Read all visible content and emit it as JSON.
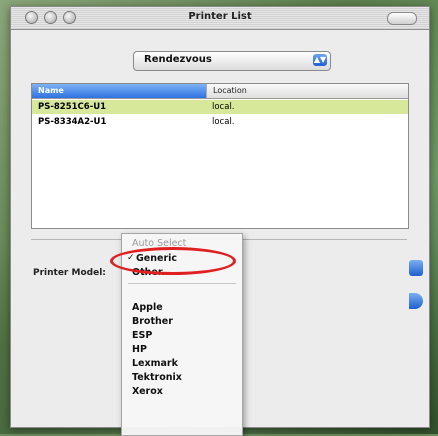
{
  "window": {
    "title": "Printer List"
  },
  "popup": {
    "label": "Rendezvous"
  },
  "list": {
    "headers": {
      "name": "Name",
      "location": "Location"
    },
    "rows": [
      {
        "name": "PS-8251C6-U1",
        "location": "local."
      },
      {
        "name": "PS-8334A2-U1",
        "location": "local."
      }
    ]
  },
  "printer_model": {
    "label": "Printer Model:"
  },
  "menu": {
    "items": [
      {
        "label": "Auto Select",
        "enabled": false
      },
      {
        "label": "Generic",
        "checked": true
      },
      {
        "label": "Other..."
      },
      {
        "label": "Apple"
      },
      {
        "label": "Brother"
      },
      {
        "label": "ESP"
      },
      {
        "label": "HP"
      },
      {
        "label": "Lexmark"
      },
      {
        "label": "Tektronix"
      },
      {
        "label": "Xerox"
      }
    ]
  },
  "icons": {
    "checkmark": "checkmark-icon",
    "popup_arrows": "popup-arrows-icon"
  },
  "colors": {
    "highlight": "#e02020",
    "selection": "#d8e89a",
    "accent": "#2f72e0"
  }
}
